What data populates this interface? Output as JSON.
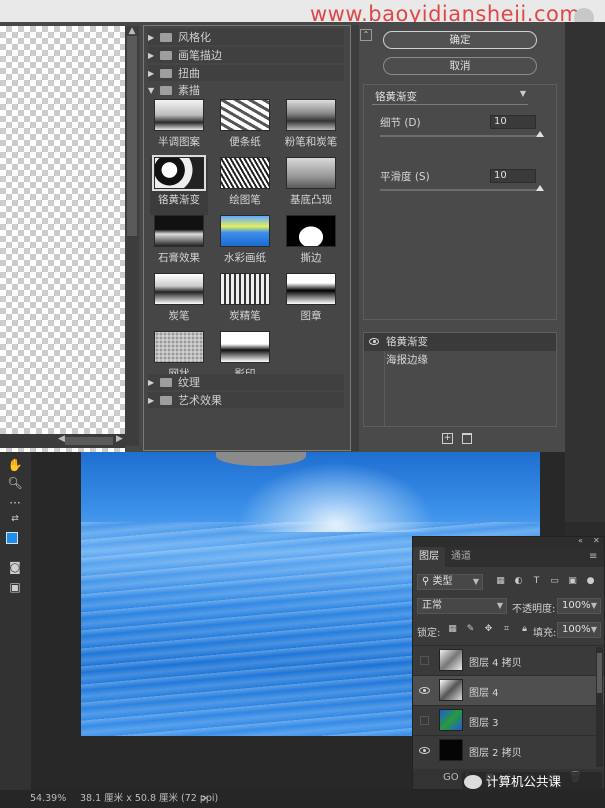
{
  "watermark": "www.baoyidiansheji.com",
  "gallery": {
    "categories": {
      "stylize": "风格化",
      "brush": "画笔描边",
      "distort": "扭曲",
      "sketch": "素描",
      "texture": "纹理",
      "artistic": "艺术效果"
    },
    "thumbs": [
      {
        "label": "半调图案"
      },
      {
        "label": "便条纸"
      },
      {
        "label": "粉笔和炭笔"
      },
      {
        "label": "铬黄渐变"
      },
      {
        "label": "绘图笔"
      },
      {
        "label": "基底凸现"
      },
      {
        "label": "石膏效果"
      },
      {
        "label": "水彩画纸"
      },
      {
        "label": "撕边"
      },
      {
        "label": "炭笔"
      },
      {
        "label": "炭精笔"
      },
      {
        "label": "图章"
      },
      {
        "label": "网状"
      },
      {
        "label": "影印"
      }
    ]
  },
  "settings": {
    "ok": "确定",
    "cancel": "取消",
    "filter_select": "铬黄渐变",
    "detail_label": "细节 (D)",
    "detail_value": "10",
    "smooth_label": "平滑度 (S)",
    "smooth_value": "10",
    "filter_layers": [
      "铬黄渐变",
      "海报边缘"
    ]
  },
  "status": {
    "zoom": "54.39%",
    "dims": "38.1 厘米 x 50.8 厘米 (72 ppi)",
    "arrow": ">"
  },
  "layers_panel": {
    "tab_layers": "图层",
    "tab_channels": "通道",
    "kind_filter": "类型",
    "blend_mode": "正常",
    "opacity_label": "不透明度:",
    "opacity_value": "100%",
    "lock_label": "锁定:",
    "fill_label": "填充:",
    "fill_value": "100%",
    "layers": [
      {
        "name": "图层 4 拷贝"
      },
      {
        "name": "图层 4"
      },
      {
        "name": "图层 3"
      },
      {
        "name": "图层 2 拷贝"
      }
    ],
    "footer": [
      "GO",
      "fx",
      "■",
      "◐",
      "▭",
      "▣",
      "🗑"
    ]
  },
  "wechat": "计算机公共课",
  "colors": {
    "accent": "#1a8ff0",
    "selected": "#4f4f4f"
  }
}
